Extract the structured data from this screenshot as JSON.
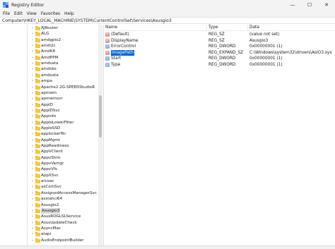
{
  "window": {
    "title": "Registry Editor",
    "minimize_glyph": "—",
    "maximize_glyph": "☐",
    "close_glyph": "✕"
  },
  "menu": [
    "File",
    "Edit",
    "View",
    "Favorites",
    "Help"
  ],
  "address": "Computer\\HKEY_LOCAL_MACHINE\\SYSTEM\\CurrentControlSet\\Services\\Asusgio3",
  "tree": {
    "chevron_glyph": "›",
    "items": [
      {
        "label": "AJRouter"
      },
      {
        "label": "ALG"
      },
      {
        "label": "amdgpio2"
      },
      {
        "label": "amdi2c"
      },
      {
        "label": "AmdK8"
      },
      {
        "label": "AmdPPM"
      },
      {
        "label": "amdsata"
      },
      {
        "label": "amdsbs"
      },
      {
        "label": "amdxata"
      },
      {
        "label": "ampa"
      },
      {
        "label": "Apache2.2G-SPEEDStudioR"
      },
      {
        "label": "apmwin"
      },
      {
        "label": "apmwinsvr"
      },
      {
        "label": "AppID"
      },
      {
        "label": "AppIDSvc"
      },
      {
        "label": "Appinfo"
      },
      {
        "label": "AppleLowerFilter"
      },
      {
        "label": "AppleSSD"
      },
      {
        "label": "applockerfltr"
      },
      {
        "label": "AppMgmt"
      },
      {
        "label": "AppReadiness"
      },
      {
        "label": "AppVClient"
      },
      {
        "label": "AppvStrm"
      },
      {
        "label": "AppvVemgr"
      },
      {
        "label": "AppvVfs"
      },
      {
        "label": "AppXSvc"
      },
      {
        "label": "arcsas"
      },
      {
        "label": "asComSvc"
      },
      {
        "label": "AssignedAccessManagerSvc"
      },
      {
        "label": "asstahci64"
      },
      {
        "label": "Asusgio2"
      },
      {
        "label": "Asusgio3",
        "selected": true
      },
      {
        "label": "AsusROGLSLService"
      },
      {
        "label": "AsusUpdateCheck"
      },
      {
        "label": "AsyncMac"
      },
      {
        "label": "atapi"
      },
      {
        "label": "AudioEndpointBuilder"
      }
    ]
  },
  "list": {
    "columns": {
      "name": "Name",
      "type": "Type",
      "data": "Data"
    },
    "rows": [
      {
        "name": "(Default)",
        "type": "REG_SZ",
        "data": "(value not set)",
        "icon": "string-value-icon",
        "glyph": "ab"
      },
      {
        "name": "DisplayName",
        "type": "REG_SZ",
        "data": "Asusgio3",
        "icon": "string-value-icon",
        "glyph": "ab"
      },
      {
        "name": "ErrorControl",
        "type": "REG_DWORD",
        "data": "0x00000001 (1)",
        "icon": "dword-value-icon",
        "glyph": "01"
      },
      {
        "name": "ImagePath",
        "type": "REG_EXPAND_SZ",
        "data": "C:\\Windows\\system32\\drivers\\AsIO3.sys",
        "icon": "string-value-icon",
        "glyph": "ab",
        "selected": true
      },
      {
        "name": "Start",
        "type": "REG_DWORD",
        "data": "0x00000001 (1)",
        "icon": "dword-value-icon",
        "glyph": "01"
      },
      {
        "name": "Type",
        "type": "REG_DWORD",
        "data": "0x00000001 (1)",
        "icon": "dword-value-icon",
        "glyph": "01"
      }
    ]
  }
}
